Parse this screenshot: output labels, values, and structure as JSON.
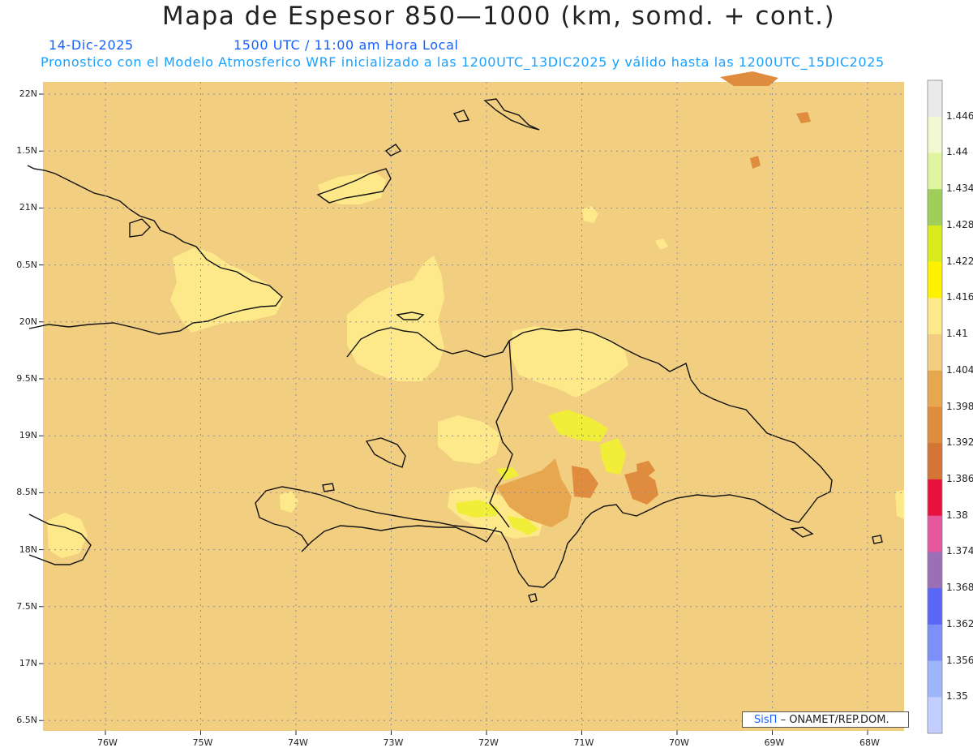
{
  "title": "Mapa de Espesor 850—1000 (km, somd. + cont.)",
  "date_line": "14-Dic-2025",
  "time_line": "1500 UTC / 11:00 am Hora Local",
  "forecast_line": "Pronostico con el Modelo Atmosferico WRF inicializado a las 1200UTC_13DIC2025 y válido hasta las  1200UTC_15DIC2025",
  "footer": {
    "brand": "SisΠ",
    "org": "– ONAMET/REP.DOM."
  },
  "lat_labels": [
    "22N",
    "1.5N",
    "21N",
    "0.5N",
    "20N",
    "9.5N",
    "19N",
    "8.5N",
    "18N",
    "7.5N",
    "17N",
    "6.5N"
  ],
  "lon_labels": [
    "76W",
    "75W",
    "74W",
    "73W",
    "72W",
    "71W",
    "70W",
    "69W",
    "68W"
  ],
  "colorbar": {
    "labels": [
      "1.446",
      "1.44",
      "1.434",
      "1.428",
      "1.422",
      "1.416",
      "1.41",
      "1.404",
      "1.398",
      "1.392",
      "1.386",
      "1.38",
      "1.374",
      "1.368",
      "1.362",
      "1.356",
      "1.35"
    ],
    "colors": [
      "#eaeaea",
      "#f2f8d2",
      "#e0f5a0",
      "#9fcf5a",
      "#d8ec1c",
      "#fff200",
      "#fde98a",
      "#f2cf80",
      "#e7a74f",
      "#e08c3e",
      "#d47535",
      "#e8103d",
      "#e5589c",
      "#9b6fb5",
      "#5a66f5",
      "#7d8ff8",
      "#9db5fb",
      "#c2cefd"
    ]
  },
  "colors": {
    "background_field": "#f2cf80",
    "light_field": "#fde98a",
    "yellow_field": "#f1ee3a",
    "orange_field": "#e7a74f",
    "dark_orange_field": "#e08c3e",
    "coastline": "#111111"
  }
}
